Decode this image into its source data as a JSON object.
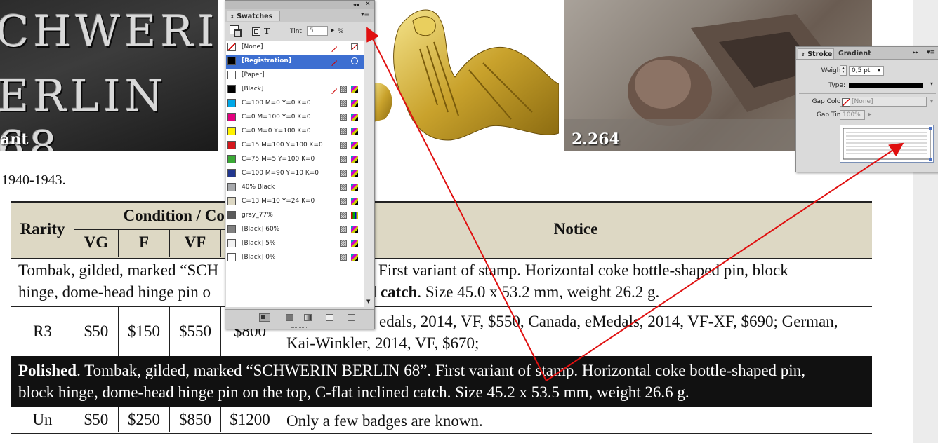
{
  "photos": {
    "photo1": {
      "engraving_line1": "CHWERIN",
      "engraving_line2": "ERLIN 68",
      "label": "ant"
    },
    "photo3": {
      "label": "2.264"
    }
  },
  "caption": {
    "year_text": "1940-1943."
  },
  "table": {
    "headers": {
      "rarity": "Rarity",
      "condition_cost": "Condition / Cost",
      "vg": "VG",
      "f": "F",
      "vf": "VF",
      "notice": "Notice"
    },
    "row1_description": [
      "Tombak, gilded, marked “SCH",
      "”. First variant of stamp. Horizontal coke bottle-shaped pin, block",
      "hinge, dome-head hinge pin o",
      "ined catch",
      ". Size 45.0 x 53.2 mm, weight 26.2 g."
    ],
    "row1_prices": {
      "rarity": "R3",
      "vg": "$50",
      "f": "$150",
      "vf": "$550",
      "xf": "$800",
      "notice_line1": "edals, 2014, VF, $550, Canada, eMedals, 2014, VF-XF, $690; German,",
      "notice_line2": "Kai-Winkler, 2014, VF, $670;"
    },
    "row2_description": {
      "bold": "Polished",
      "line1": ". Tombak, gilded, marked “SCHWERIN BERLIN 68”. First variant of stamp. Horizontal coke bottle-shaped pin,",
      "line2": "block hinge, dome-head hinge pin on the top, C-flat inclined catch. Size 45.2 x 53.5 mm, weight 26.6 g."
    },
    "row2_prices": {
      "rarity": "Un",
      "vg": "$50",
      "f": "$250",
      "vf": "$850",
      "xf": "$1200",
      "notice": "Only a few badges are known."
    }
  },
  "swatches_panel": {
    "title": "Swatches",
    "tint_label": "Tint:",
    "tint_value": "5",
    "tint_unit": "%",
    "text_toggle": "T",
    "items": [
      {
        "name": "[None]",
        "color": "#ffffff"
      },
      {
        "name": "[Registration]",
        "color": "#000000"
      },
      {
        "name": "[Paper]",
        "color": "#ffffff"
      },
      {
        "name": "[Black]",
        "color": "#000000"
      },
      {
        "name": "C=100 M=0 Y=0 K=0",
        "color": "#00a8e8"
      },
      {
        "name": "C=0 M=100 Y=0 K=0",
        "color": "#e4007f"
      },
      {
        "name": "C=0 M=0 Y=100 K=0",
        "color": "#fff200"
      },
      {
        "name": "C=15 M=100 Y=100 K=0",
        "color": "#d4161c"
      },
      {
        "name": "C=75 M=5 Y=100 K=0",
        "color": "#3aa935"
      },
      {
        "name": "C=100 M=90 Y=10 K=0",
        "color": "#21378f"
      },
      {
        "name": "40% Black",
        "color": "#a7a9ac"
      },
      {
        "name": "C=13 M=10 Y=24 K=0",
        "color": "#ddd8c4"
      },
      {
        "name": "gray_77%",
        "color": "#5a5a5a"
      },
      {
        "name": "[Black] 60%",
        "color": "#808080"
      },
      {
        "name": "[Black] 5%",
        "color": "#f2f2f2"
      },
      {
        "name": "[Black] 0%",
        "color": "#ffffff"
      }
    ],
    "selected": "[Registration]"
  },
  "stroke_panel": {
    "tab_stroke": "Stroke",
    "tab_gradient": "Gradient",
    "weight_label": "Weight:",
    "weight_value": "0,5 pt",
    "type_label": "Type:",
    "gap_color_label": "Gap Color:",
    "gap_color_value": "[None]",
    "gap_tint_label": "Gap Tint:",
    "gap_tint_value": "100%"
  },
  "colors": {
    "header_bg": "#ddd8c4",
    "dark_row_bg": "#111111",
    "selection": "#3d6fd1",
    "annotation_arrow": "#e01010"
  },
  "icons": [
    "collapse-icon",
    "close-icon",
    "panel-menu-icon",
    "fill-stroke-icon",
    "container-format-icon",
    "text-format-icon",
    "reg-no-edit-icon",
    "reg-target-icon",
    "cmyk-process-icon",
    "new-swatch-icon",
    "delete-swatch-icon",
    "show-all-icon",
    "gradient-swatch-icon",
    "color-swatch-icon"
  ]
}
